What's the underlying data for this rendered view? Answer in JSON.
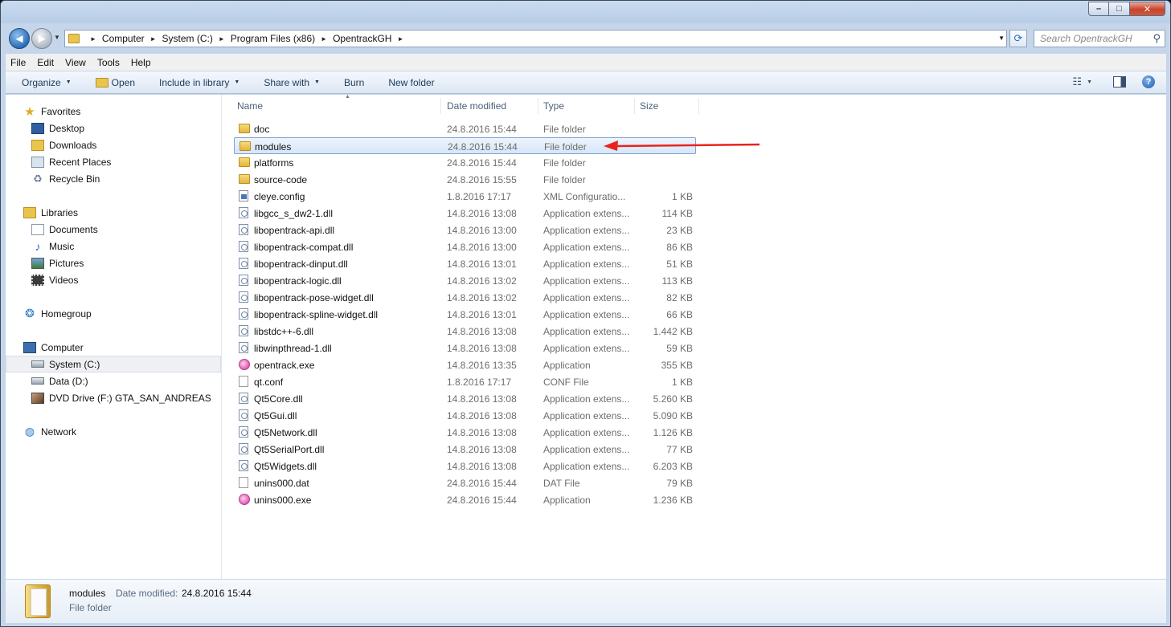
{
  "window": {
    "controls": {
      "minimize": "–",
      "maximize": "□",
      "close": "✕"
    }
  },
  "navigation": {
    "back_glyph": "◄",
    "forward_glyph": "►",
    "breadcrumbs": [
      "Computer",
      "System (C:)",
      "Program Files (x86)",
      "OpentrackGH"
    ],
    "search_placeholder": "Search OpentrackGH"
  },
  "menu": [
    "File",
    "Edit",
    "View",
    "Tools",
    "Help"
  ],
  "toolbar": {
    "organize": "Organize",
    "open": "Open",
    "include_in_library": "Include in library",
    "share_with": "Share with",
    "burn": "Burn",
    "new_folder": "New folder",
    "help_glyph": "?"
  },
  "sidebar": {
    "favorites": "Favorites",
    "favorites_items": [
      "Desktop",
      "Downloads",
      "Recent Places",
      "Recycle Bin"
    ],
    "libraries": "Libraries",
    "libraries_items": [
      "Documents",
      "Music",
      "Pictures",
      "Videos"
    ],
    "homegroup": "Homegroup",
    "computer": "Computer",
    "computer_items": [
      "System (C:)",
      "Data (D:)",
      "DVD Drive (F:) GTA_SAN_ANDREAS"
    ],
    "network": "Network"
  },
  "columns": {
    "name": "Name",
    "date": "Date modified",
    "type": "Type",
    "size": "Size"
  },
  "files": [
    {
      "name": "doc",
      "date": "24.8.2016 15:44",
      "type": "File folder",
      "size": "",
      "icon": "folder"
    },
    {
      "name": "modules",
      "date": "24.8.2016 15:44",
      "type": "File folder",
      "size": "",
      "icon": "folder"
    },
    {
      "name": "platforms",
      "date": "24.8.2016 15:44",
      "type": "File folder",
      "size": "",
      "icon": "folder"
    },
    {
      "name": "source-code",
      "date": "24.8.2016 15:55",
      "type": "File folder",
      "size": "",
      "icon": "folder"
    },
    {
      "name": "cleye.config",
      "date": "1.8.2016 17:17",
      "type": "XML Configuratio...",
      "size": "1 KB",
      "icon": "config"
    },
    {
      "name": "libgcc_s_dw2-1.dll",
      "date": "14.8.2016 13:08",
      "type": "Application extens...",
      "size": "114 KB",
      "icon": "dll"
    },
    {
      "name": "libopentrack-api.dll",
      "date": "14.8.2016 13:00",
      "type": "Application extens...",
      "size": "23 KB",
      "icon": "dll"
    },
    {
      "name": "libopentrack-compat.dll",
      "date": "14.8.2016 13:00",
      "type": "Application extens...",
      "size": "86 KB",
      "icon": "dll"
    },
    {
      "name": "libopentrack-dinput.dll",
      "date": "14.8.2016 13:01",
      "type": "Application extens...",
      "size": "51 KB",
      "icon": "dll"
    },
    {
      "name": "libopentrack-logic.dll",
      "date": "14.8.2016 13:02",
      "type": "Application extens...",
      "size": "113 KB",
      "icon": "dll"
    },
    {
      "name": "libopentrack-pose-widget.dll",
      "date": "14.8.2016 13:02",
      "type": "Application extens...",
      "size": "82 KB",
      "icon": "dll"
    },
    {
      "name": "libopentrack-spline-widget.dll",
      "date": "14.8.2016 13:01",
      "type": "Application extens...",
      "size": "66 KB",
      "icon": "dll"
    },
    {
      "name": "libstdc++-6.dll",
      "date": "14.8.2016 13:08",
      "type": "Application extens...",
      "size": "1.442 KB",
      "icon": "dll"
    },
    {
      "name": "libwinpthread-1.dll",
      "date": "14.8.2016 13:08",
      "type": "Application extens...",
      "size": "59 KB",
      "icon": "dll"
    },
    {
      "name": "opentrack.exe",
      "date": "14.8.2016 13:35",
      "type": "Application",
      "size": "355 KB",
      "icon": "exe"
    },
    {
      "name": "qt.conf",
      "date": "1.8.2016 17:17",
      "type": "CONF File",
      "size": "1 KB",
      "icon": "blank"
    },
    {
      "name": "Qt5Core.dll",
      "date": "14.8.2016 13:08",
      "type": "Application extens...",
      "size": "5.260 KB",
      "icon": "dll"
    },
    {
      "name": "Qt5Gui.dll",
      "date": "14.8.2016 13:08",
      "type": "Application extens...",
      "size": "5.090 KB",
      "icon": "dll"
    },
    {
      "name": "Qt5Network.dll",
      "date": "14.8.2016 13:08",
      "type": "Application extens...",
      "size": "1.126 KB",
      "icon": "dll"
    },
    {
      "name": "Qt5SerialPort.dll",
      "date": "14.8.2016 13:08",
      "type": "Application extens...",
      "size": "77 KB",
      "icon": "dll"
    },
    {
      "name": "Qt5Widgets.dll",
      "date": "14.8.2016 13:08",
      "type": "Application extens...",
      "size": "6.203 KB",
      "icon": "dll"
    },
    {
      "name": "unins000.dat",
      "date": "24.8.2016 15:44",
      "type": "DAT File",
      "size": "79 KB",
      "icon": "blank"
    },
    {
      "name": "unins000.exe",
      "date": "24.8.2016 15:44",
      "type": "Application",
      "size": "1.236 KB",
      "icon": "exe"
    }
  ],
  "selected_index": 1,
  "annotation_color": "#e8231e",
  "details": {
    "name": "modules",
    "date_label": "Date modified:",
    "date_value": "24.8.2016 15:44",
    "type": "File folder"
  }
}
